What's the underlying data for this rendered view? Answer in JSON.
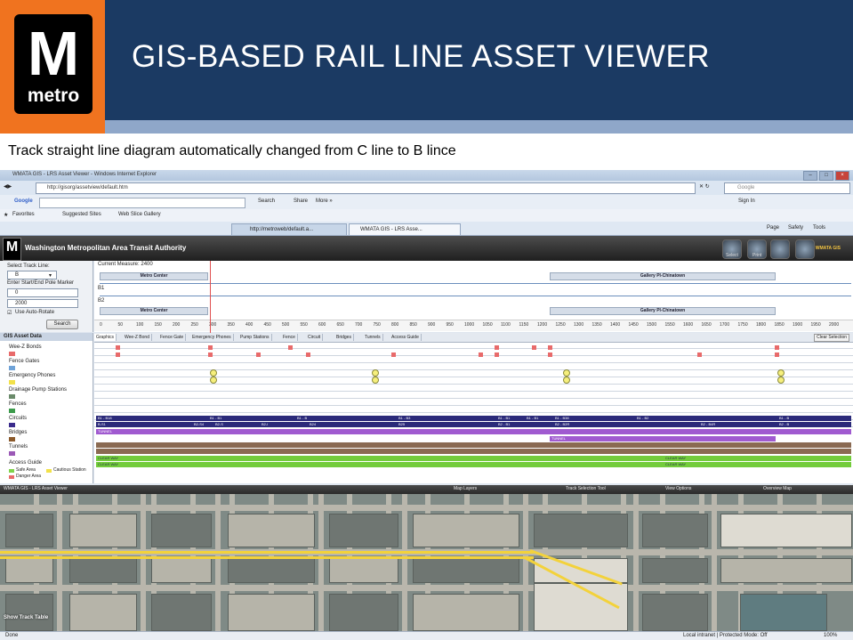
{
  "slide": {
    "title": "GIS-BASED RAIL LINE ASSET VIEWER",
    "logo_word": "metro",
    "logo_letter": "M",
    "caption": "Track straight line diagram automatically changed from C line to B lince"
  },
  "browser": {
    "window_title": "WMATA GIS - LRS Asset Viewer - Windows Internet Explorer",
    "address": "http://gisorg/assetview/default.htm",
    "web_search": "Google",
    "google_label": "Google",
    "google_buttons": [
      "Search",
      "Share",
      "More »"
    ],
    "signin": "Sign In",
    "favorites_label": "Favorites",
    "favorites": [
      "Suggested Sites",
      "Web Slice Gallery"
    ],
    "tabs": [
      "http://metroweb/default.a...",
      "WMATA GIS - LRS Asse..."
    ],
    "command_bar": [
      "Page",
      "Safety",
      "Tools"
    ],
    "status_left": "Done",
    "status_right": "Local intranet | Protected Mode: Off",
    "zoom": "100%"
  },
  "app": {
    "logo_letter": "M",
    "title": "Washington Metropolitan Area Transit Authority",
    "brand": "WMATA GIS",
    "toolbar": [
      "Select",
      "Print",
      "Overview",
      "Measure"
    ],
    "left_panel": {
      "track_line_label": "Select Track Line:",
      "track_line_value": "B",
      "range_label": "Enter Start/End Pole Marker",
      "start_value": "0",
      "end_value": "2000",
      "auto_rotate_label": "Use Auto-Rotate",
      "search_button": "Search"
    },
    "line_diagram": {
      "current_measure": "Current Measure: 2400",
      "stations_top": [
        "Metro Center",
        "Gallery Pl-Chinatown"
      ],
      "stations_bottom": [
        "Metro Center",
        "Gallery Pl-Chinatown"
      ],
      "tracks": [
        "B1",
        "B2"
      ],
      "ruler_ticks": [
        "0",
        "50",
        "100",
        "150",
        "200",
        "250",
        "300",
        "350",
        "400",
        "450",
        "500",
        "550",
        "600",
        "650",
        "700",
        "750",
        "800",
        "850",
        "900",
        "950",
        "1000",
        "1050",
        "1100",
        "1150",
        "1200",
        "1250",
        "1300",
        "1350",
        "1400",
        "1450",
        "1500",
        "1550",
        "1600",
        "1650",
        "1700",
        "1750",
        "1800",
        "1850",
        "1900",
        "1950",
        "2000"
      ]
    },
    "asset_panel": {
      "header": "GIS Asset Data",
      "items": [
        {
          "label": "Wee-Z Bonds",
          "color": "#e86a6a"
        },
        {
          "label": "Fence Gates",
          "color": "#6fa3d8"
        },
        {
          "label": "Emergency Phones",
          "color": "#f2e14a"
        },
        {
          "label": "Drainage Pump Stations",
          "color": "#6a8a6a"
        },
        {
          "label": "Fences",
          "color": "#3b9a4a"
        },
        {
          "label": "Circuits",
          "color": "#3a2b8c"
        },
        {
          "label": "Bridges",
          "color": "#8b5a2b"
        },
        {
          "label": "Tunnels",
          "color": "#9b59b6"
        }
      ],
      "access_guide": {
        "title": "Access Guide",
        "items": [
          {
            "label": "Safe Area",
            "color": "#7fd34a"
          },
          {
            "label": "Cautious Station",
            "color": "#f2e14a"
          },
          {
            "label": "Danger Area",
            "color": "#e86a6a"
          }
        ]
      }
    },
    "asset_tabs": [
      "Graphics",
      "Wee-Z Bond",
      "Fence Gate",
      "Emergency Phones",
      "Pump Stations",
      "Fence",
      "Circuit",
      "Bridges",
      "Tunnels",
      "Access Guide"
    ],
    "clear_selection": "Clear Selection",
    "band_labels": {
      "circuit_a": [
        "B1 - B18",
        "B1 - B1",
        "B1 - B",
        "B1 - B3",
        "B1 - B1",
        "B1 - B1",
        "B1 - B38",
        "B1 - B2",
        "B1 - B"
      ],
      "circuit_b": [
        "B-S1",
        "B2-S4",
        "B2-S",
        "B2-I",
        "B24",
        "B25",
        "B2 - B1",
        "B2 - B2R",
        "B2 - B4R",
        "B2 - B"
      ],
      "tunnel_a": "TUNNEL",
      "tunnel_b": "TUNNEL",
      "access_a": [
        "CLEAR WAY",
        "CLEAR WAY"
      ],
      "access_b": [
        "CLEAR WAY",
        "CLEAR WAY"
      ]
    },
    "bottom_panels": [
      "WMATA GIS - LRS Asset Viewer",
      "Map Layers",
      "Track Selection Tool",
      "View Options",
      "Overview Map"
    ],
    "show_track_table": "Show Track Table"
  }
}
